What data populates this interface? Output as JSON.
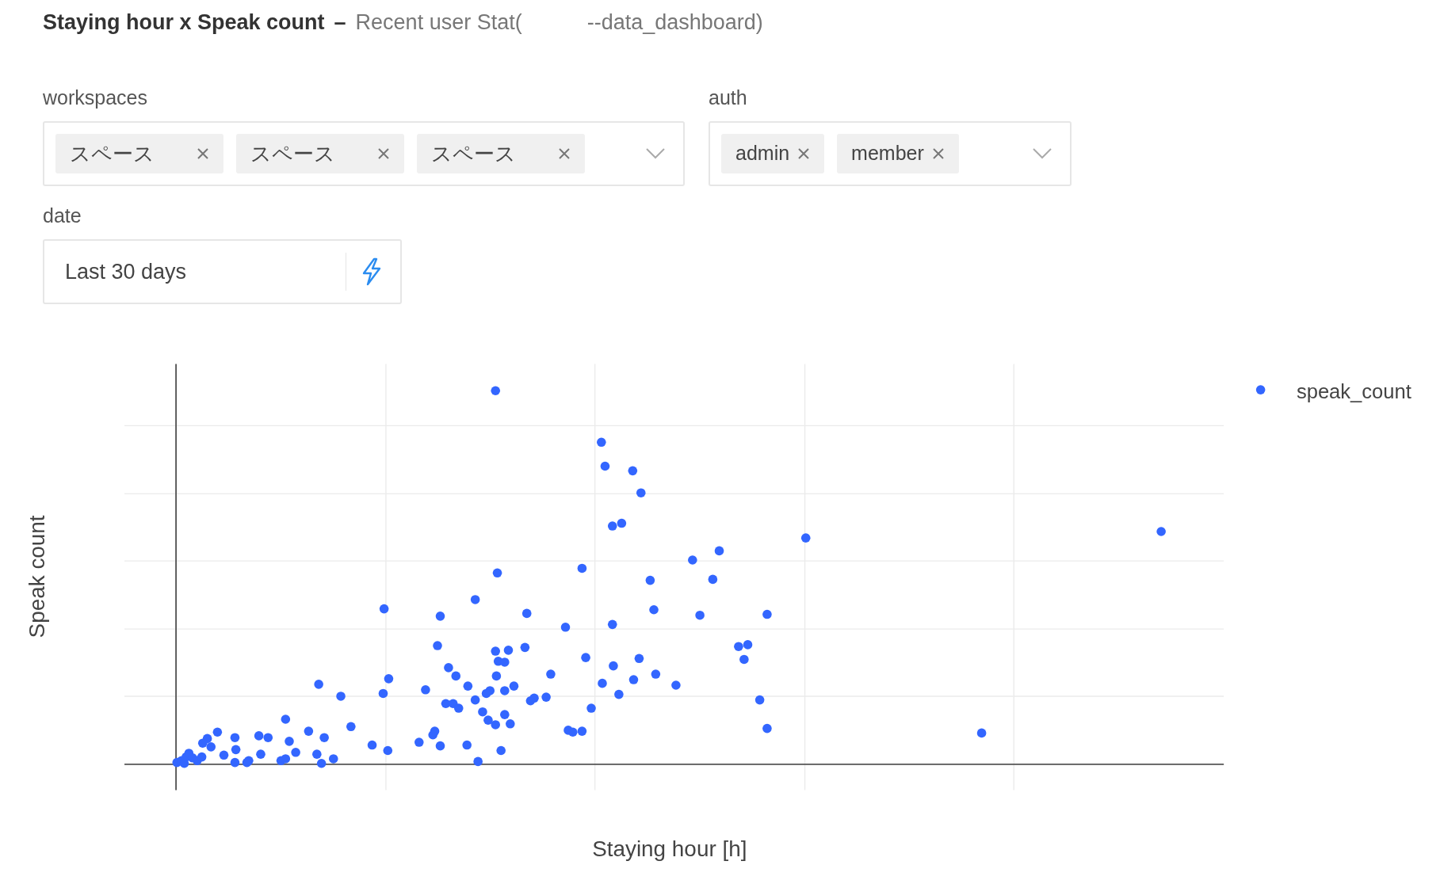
{
  "title": {
    "main": "Staying hour x Speak count",
    "separator": "–",
    "source_start": "Recent user Stat(",
    "source_end": "--data_dashboard)"
  },
  "filters": [
    {
      "label": "workspaces",
      "kind": "multi",
      "tags": [
        "スペース",
        "スペース",
        "スペース"
      ]
    },
    {
      "label": "auth",
      "kind": "multi",
      "tags": [
        "admin",
        "member"
      ]
    },
    {
      "label": "date",
      "kind": "date",
      "value": "Last 30 days"
    }
  ],
  "chart": {
    "xlabel": "Staying hour [h]",
    "ylabel": "Speak count",
    "legend": [
      "speak_count"
    ]
  }
}
